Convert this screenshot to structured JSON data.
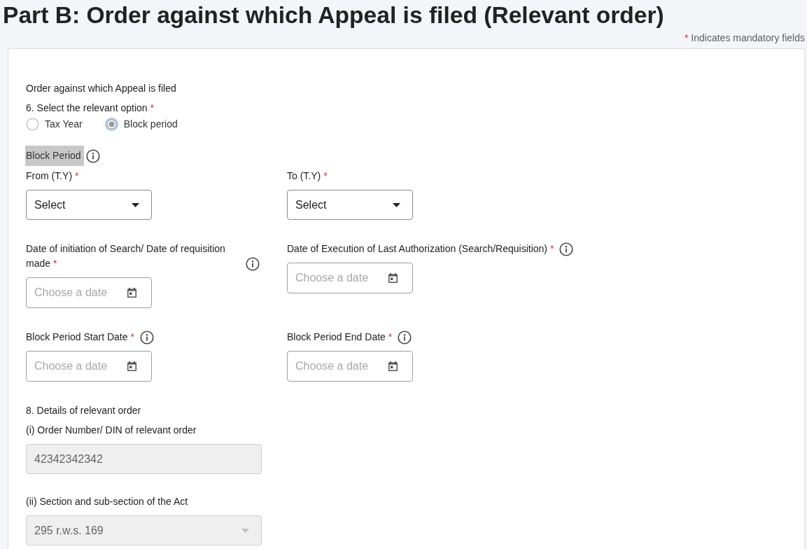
{
  "header": {
    "title": "Part B: Order against which Appeal is filed (Relevant order)",
    "mandatory_note": {
      "mark": "*",
      "text": "Indicates mandatory fields"
    }
  },
  "form": {
    "section_label": "Order against which Appeal is filed",
    "option_question": {
      "label": "6. Select the relevant option",
      "required_mark": "*",
      "options": [
        {
          "label": "Tax Year",
          "selected": false
        },
        {
          "label": "Block period",
          "selected": true
        }
      ]
    },
    "block_period": {
      "heading": "Block Period",
      "highlighted": true,
      "info": true,
      "rows": [
        {
          "fields": [
            {
              "kind": "select",
              "label": "From (T.Y)",
              "required_mark": "*",
              "info": false,
              "value": "Select",
              "disabled": false
            },
            {
              "kind": "select",
              "label": "To (T.Y)",
              "required_mark": "*",
              "info": false,
              "value": "Select",
              "disabled": false
            }
          ]
        },
        {
          "fields": [
            {
              "kind": "date",
              "label": "Date of initiation of Search/ Date of requisition made",
              "required_mark": "*",
              "info": true,
              "placeholder": "Choose a date",
              "disabled": false
            },
            {
              "kind": "date",
              "label": "Date of Execution of Last Authorization (Search/Requisition)",
              "required_mark": "*",
              "info": true,
              "placeholder": "Choose a date",
              "disabled": false
            }
          ]
        },
        {
          "fields": [
            {
              "kind": "date",
              "label": "Block Period Start Date",
              "required_mark": "*",
              "info": true,
              "placeholder": "Choose a date",
              "disabled": false
            },
            {
              "kind": "date",
              "label": "Block Period End Date",
              "required_mark": "*",
              "info": true,
              "placeholder": "Choose a date",
              "disabled": false
            }
          ]
        }
      ]
    },
    "order_details": {
      "heading": "8. Details of relevant order",
      "fields": [
        {
          "kind": "text",
          "label": "(i) Order Number/ DIN of relevant order",
          "info": false,
          "value": "42342342342",
          "disabled": true
        },
        {
          "kind": "select",
          "label": "(ii) Section and sub-section of the Act",
          "info": false,
          "value": "295 r.w.s. 169",
          "disabled": true
        }
      ]
    }
  }
}
